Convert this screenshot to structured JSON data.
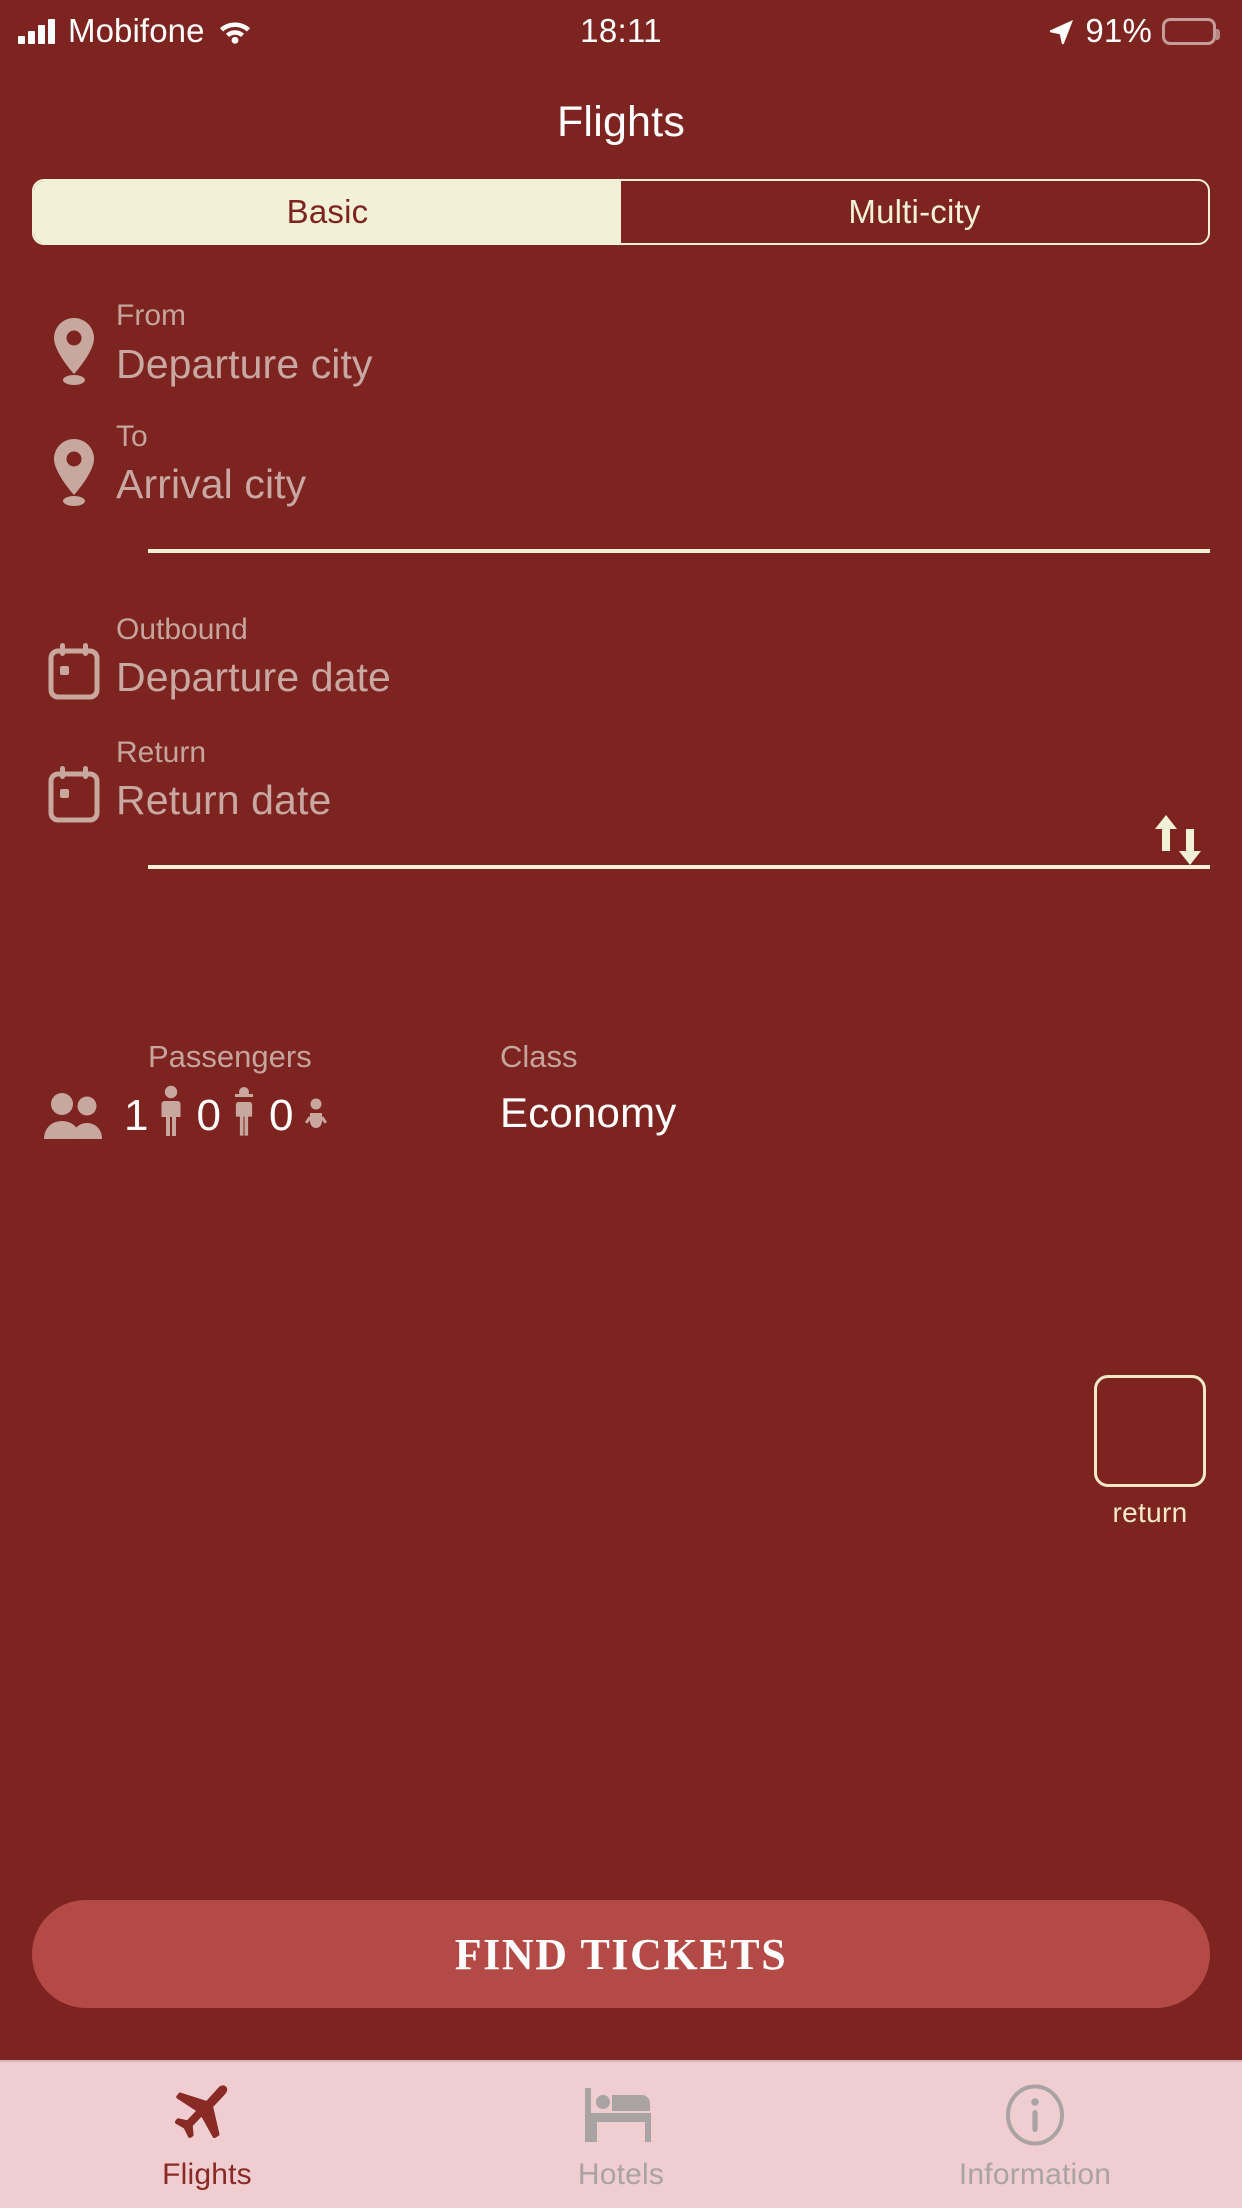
{
  "statusbar": {
    "carrier": "Mobifone",
    "time": "18:11",
    "battery_percent": "91%",
    "signal_icon": "cellular-signal-icon",
    "wifi_icon": "wifi-icon",
    "location_icon": "location-arrow-icon",
    "battery_icon": "battery-icon"
  },
  "header": {
    "title": "Flights"
  },
  "segmented": {
    "options": [
      {
        "label": "Basic",
        "active": true
      },
      {
        "label": "Multi-city",
        "active": false
      }
    ]
  },
  "route": {
    "from": {
      "label": "From",
      "placeholder": "Departure city",
      "icon": "map-pin-icon"
    },
    "to": {
      "label": "To",
      "placeholder": "Arrival city",
      "icon": "map-pin-icon"
    },
    "swap_icon": "swap-vertical-arrows-icon"
  },
  "dates": {
    "outbound": {
      "label": "Outbound",
      "placeholder": "Departure date",
      "icon": "calendar-icon"
    },
    "return": {
      "label": "Return",
      "placeholder": "Return date",
      "icon": "calendar-icon"
    },
    "return_toggle": {
      "caption": "return",
      "checked": false
    }
  },
  "passengers": {
    "label": "Passengers",
    "icon": "people-icon",
    "adults": "1",
    "adult_icon": "adult-icon",
    "children": "0",
    "child_icon": "child-icon",
    "infants": "0",
    "infant_icon": "infant-icon"
  },
  "travel_class": {
    "label": "Class",
    "value": "Economy"
  },
  "cta": {
    "label": "FIND TICKETS"
  },
  "tabbar": {
    "tabs": [
      {
        "label": "Flights",
        "icon": "airplane-icon",
        "active": true
      },
      {
        "label": "Hotels",
        "icon": "bed-icon",
        "active": false
      },
      {
        "label": "Information",
        "icon": "info-circle-icon",
        "active": false
      }
    ]
  },
  "colors": {
    "background": "#7d2420",
    "cream": "#f2f1d8",
    "muted_text": "#c6a49e",
    "cta_bg": "#b44a46",
    "tabbar_bg": "#efcdd1",
    "tab_active": "#8a2a24",
    "tab_idle": "#a9a3a3"
  }
}
